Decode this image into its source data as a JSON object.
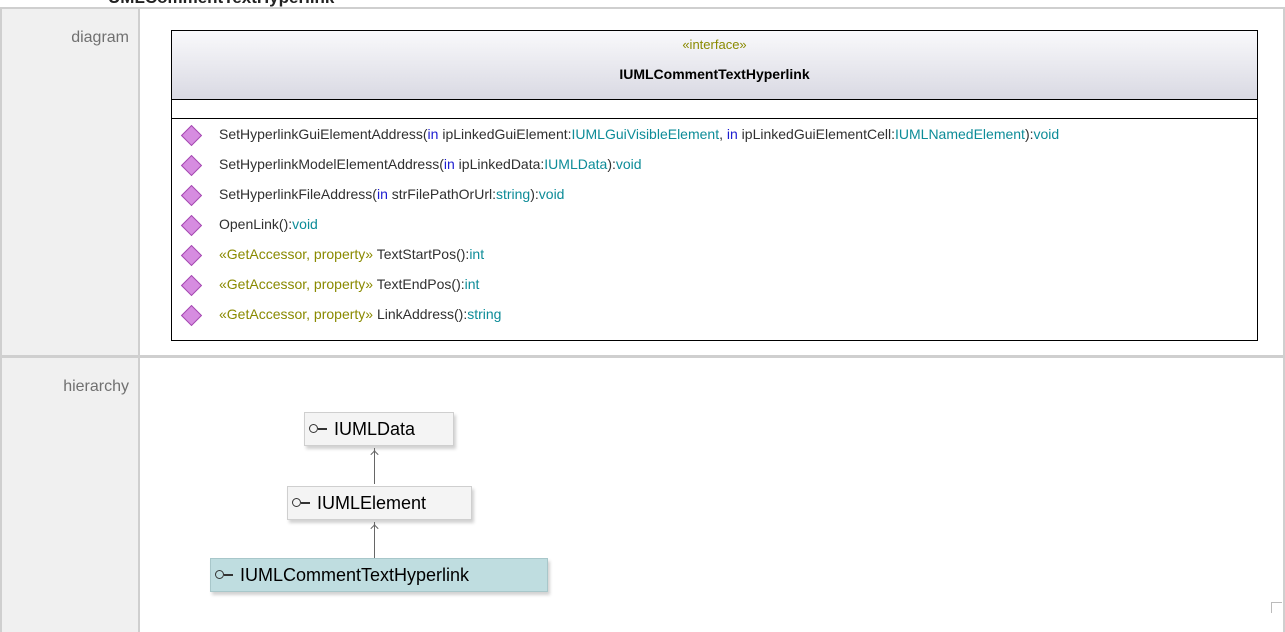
{
  "page": {
    "cut_title": "UMLCommentTextHyperlink"
  },
  "rows": {
    "diagram_label": "diagram",
    "hierarchy_label": "hierarchy"
  },
  "uml": {
    "stereotype": "«interface»",
    "class_name": "IUMLCommentTextHyperlink",
    "operations": [
      {
        "icon": "operation-diamond-icon",
        "parts": [
          {
            "t": "SetHyperlinkGuiElementAddress(",
            "s": "pl"
          },
          {
            "t": "in",
            "s": "kw"
          },
          {
            "t": " ipLinkedGuiElement:",
            "s": "pl"
          },
          {
            "t": "IUMLGuiVisibleElement",
            "s": "ty"
          },
          {
            "t": ", ",
            "s": "pl"
          },
          {
            "t": "in",
            "s": "kw"
          },
          {
            "t": " ipLinkedGuiElementCell:",
            "s": "pl"
          },
          {
            "t": "IUMLNamedElement",
            "s": "ty"
          },
          {
            "t": "):",
            "s": "pl"
          },
          {
            "t": "void",
            "s": "ty"
          }
        ]
      },
      {
        "icon": "operation-diamond-icon",
        "parts": [
          {
            "t": "SetHyperlinkModelElementAddress(",
            "s": "pl"
          },
          {
            "t": "in",
            "s": "kw"
          },
          {
            "t": " ipLinkedData:",
            "s": "pl"
          },
          {
            "t": "IUMLData",
            "s": "ty"
          },
          {
            "t": "):",
            "s": "pl"
          },
          {
            "t": "void",
            "s": "ty"
          }
        ]
      },
      {
        "icon": "operation-diamond-icon",
        "parts": [
          {
            "t": "SetHyperlinkFileAddress(",
            "s": "pl"
          },
          {
            "t": "in",
            "s": "kw"
          },
          {
            "t": " strFilePathOrUrl:",
            "s": "pl"
          },
          {
            "t": "string",
            "s": "ty"
          },
          {
            "t": "):",
            "s": "pl"
          },
          {
            "t": "void",
            "s": "ty"
          }
        ]
      },
      {
        "icon": "operation-diamond-icon",
        "parts": [
          {
            "t": "OpenLink():",
            "s": "pl"
          },
          {
            "t": "void",
            "s": "ty"
          }
        ]
      },
      {
        "icon": "operation-diamond-icon",
        "parts": [
          {
            "t": "«GetAccessor, property» ",
            "s": "st"
          },
          {
            "t": "TextStartPos():",
            "s": "pl"
          },
          {
            "t": "int",
            "s": "ty"
          }
        ]
      },
      {
        "icon": "operation-diamond-icon",
        "parts": [
          {
            "t": "«GetAccessor, property» ",
            "s": "st"
          },
          {
            "t": "TextEndPos():",
            "s": "pl"
          },
          {
            "t": "int",
            "s": "ty"
          }
        ]
      },
      {
        "icon": "operation-diamond-icon",
        "parts": [
          {
            "t": "«GetAccessor, property» ",
            "s": "st"
          },
          {
            "t": "LinkAddress():",
            "s": "pl"
          },
          {
            "t": "string",
            "s": "ty"
          }
        ]
      }
    ]
  },
  "hierarchy": {
    "items": [
      {
        "name": "IUMLData",
        "icon": "interface-lollipop-icon",
        "current": false
      },
      {
        "name": "IUMLElement",
        "icon": "interface-lollipop-icon",
        "current": false
      },
      {
        "name": "IUMLCommentTextHyperlink",
        "icon": "interface-lollipop-icon",
        "current": true
      }
    ]
  },
  "colors": {
    "keyword": "#1c1cd0",
    "type": "#0d8c98",
    "stereotype": "#8a8a00",
    "current_highlight": "#bfdde0"
  }
}
